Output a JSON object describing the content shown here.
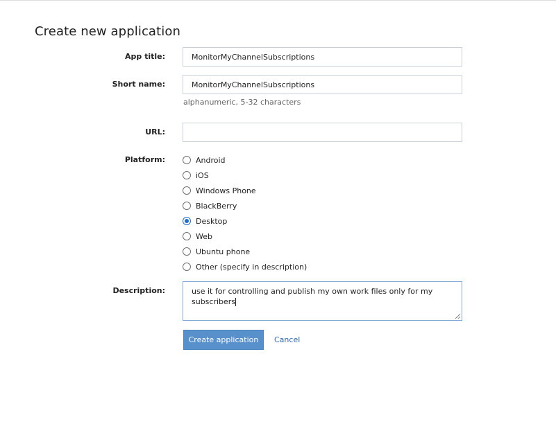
{
  "page": {
    "title": "Create new application"
  },
  "form": {
    "app_title": {
      "label": "App title:",
      "value": "MonitorMyChannelSubscriptions"
    },
    "short_name": {
      "label": "Short name:",
      "value": "MonitorMyChannelSubscriptions",
      "hint": "alphanumeric, 5-32 characters"
    },
    "url": {
      "label": "URL:",
      "value": ""
    },
    "platform": {
      "label": "Platform:",
      "selected": "Desktop",
      "options": [
        {
          "label": "Android",
          "checked": false
        },
        {
          "label": "iOS",
          "checked": false
        },
        {
          "label": "Windows Phone",
          "checked": false
        },
        {
          "label": "BlackBerry",
          "checked": false
        },
        {
          "label": "Desktop",
          "checked": true
        },
        {
          "label": "Web",
          "checked": false
        },
        {
          "label": "Ubuntu phone",
          "checked": false
        },
        {
          "label": "Other (specify in description)",
          "checked": false
        }
      ]
    },
    "description": {
      "label": "Description:",
      "value": "use it for controlling and publish my own work files only for my subscribers"
    }
  },
  "actions": {
    "create_label": "Create application",
    "cancel_label": "Cancel"
  },
  "colors": {
    "primary_button": "#5890cc",
    "link": "#2b6ab5",
    "radio_checked": "#1f6fd1",
    "focus_border": "#7fa8d8"
  }
}
